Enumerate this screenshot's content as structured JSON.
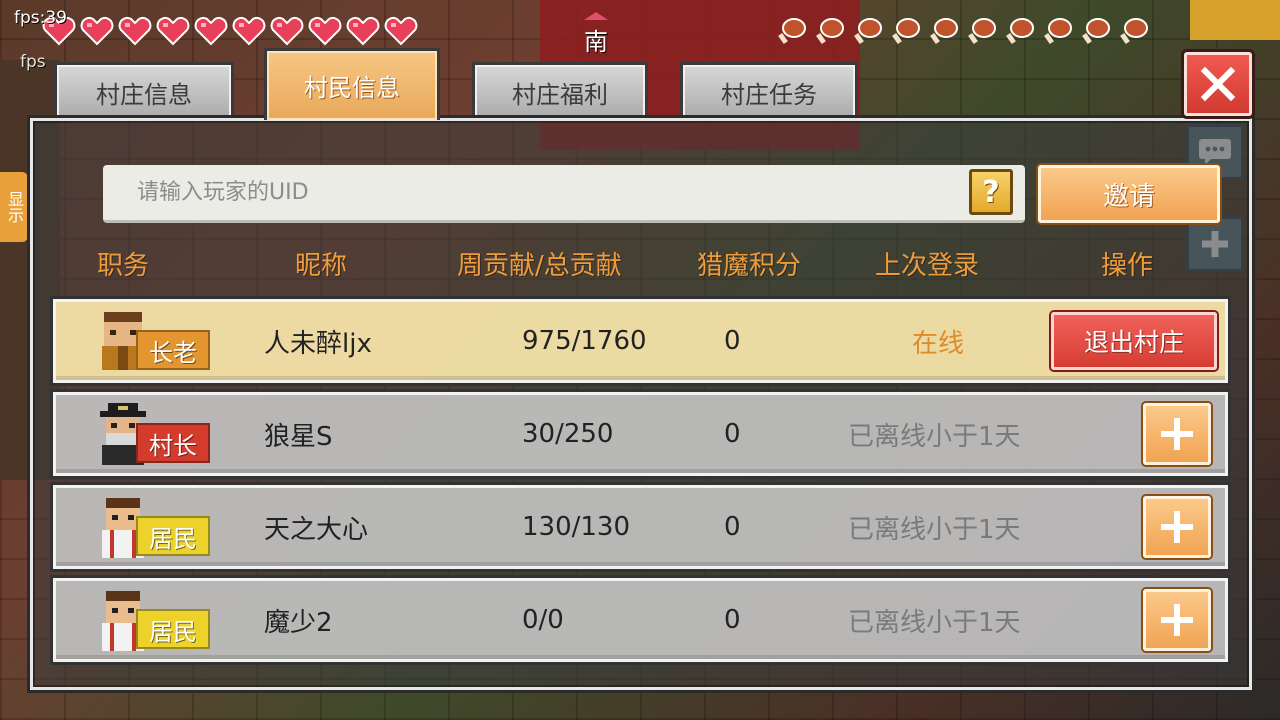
{
  "hud": {
    "fps_label": "fps:39",
    "fps_label_2": "fps",
    "compass": "南",
    "hearts": 10,
    "food": 10,
    "left_hint": "显示"
  },
  "tabs": [
    {
      "label": "村庄信息",
      "active": false
    },
    {
      "label": "村民信息",
      "active": true
    },
    {
      "label": "村庄福利",
      "active": false
    },
    {
      "label": "村庄任务",
      "active": false
    }
  ],
  "search": {
    "placeholder": "请输入玩家的UID",
    "help": "?"
  },
  "invite_label": "邀请",
  "columns": [
    "职务",
    "昵称",
    "周贡献/总贡献",
    "猎魔积分",
    "上次登录",
    "操作"
  ],
  "members": [
    {
      "role": "长老",
      "role_type": "elder",
      "name": "人未醉ljx",
      "contribution": "975/1760",
      "score": "0",
      "status": "在线",
      "online": true,
      "action": "退出村庄"
    },
    {
      "role": "村长",
      "role_type": "chief",
      "name": "狼星S",
      "contribution": "30/250",
      "score": "0",
      "status": "已离线小于1天",
      "online": false,
      "action": "+"
    },
    {
      "role": "居民",
      "role_type": "resident",
      "name": "天之大心",
      "contribution": "130/130",
      "score": "0",
      "status": "已离线小于1天",
      "online": false,
      "action": "+"
    },
    {
      "role": "居民",
      "role_type": "resident",
      "name": "魔少2",
      "contribution": "0/0",
      "score": "0",
      "status": "已离线小于1天",
      "online": false,
      "action": "+"
    }
  ],
  "colors": {
    "accent_orange": "#f1a353",
    "header_orange": "#ee9b3a",
    "danger_red": "#d63d33",
    "online_orange": "#e08b2a"
  }
}
